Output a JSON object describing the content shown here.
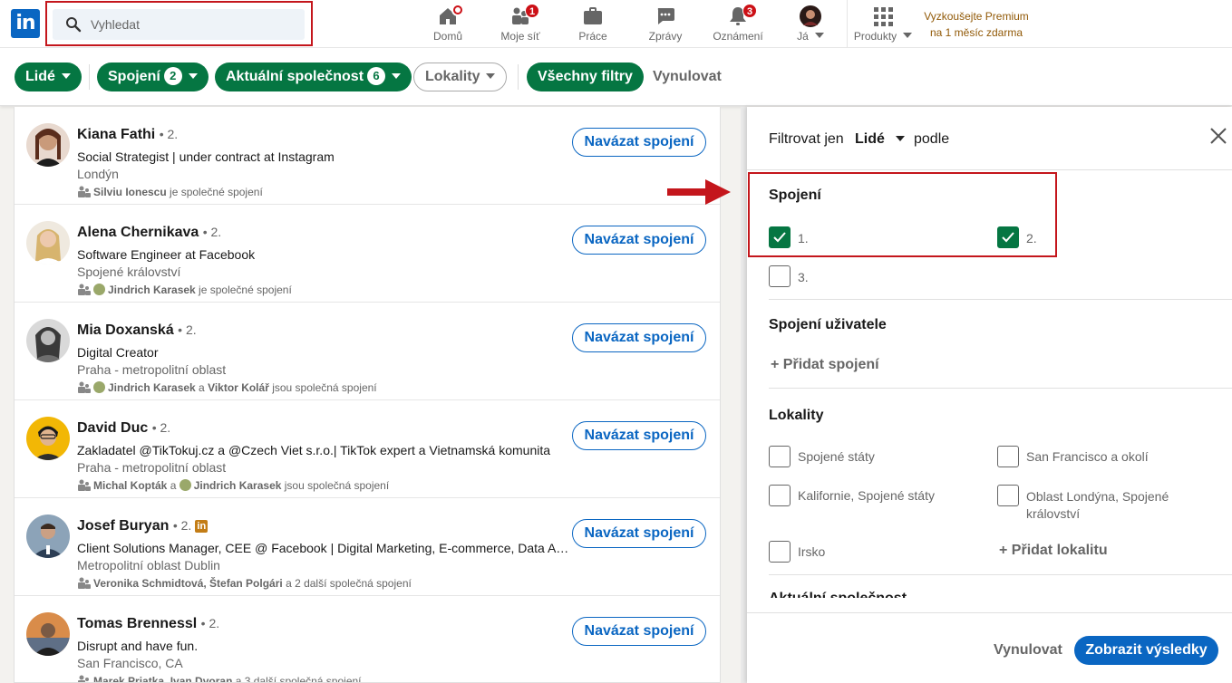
{
  "nav": {
    "logo": "in",
    "search_placeholder": "Vyhledat",
    "items": [
      {
        "label": "Domů"
      },
      {
        "label": "Moje síť",
        "badge": "1"
      },
      {
        "label": "Práce"
      },
      {
        "label": "Zprávy"
      },
      {
        "label": "Oznámení",
        "badge": "3"
      },
      {
        "label": "Já"
      },
      {
        "label": "Produkty"
      }
    ],
    "premium_line1": "Vyzkoušejte Premium",
    "premium_line2": "na 1 měsíc zdarma"
  },
  "filters": {
    "people": "Lidé",
    "connections": "Spojení",
    "connections_count": "2",
    "company": "Aktuální společnost",
    "company_count": "6",
    "locations": "Lokality",
    "all_filters": "Všechny filtry",
    "reset": "Vynulovat"
  },
  "results": [
    {
      "name": "Kiana Fathi",
      "degree": "• 2.",
      "headline": "Social Strategist | under contract at Instagram",
      "location": "Londýn",
      "mutual_names": "Silviu Ionescu",
      "mutual_suffix": " je společné spojení",
      "action": "Navázat spojení"
    },
    {
      "name": "Alena Chernikava",
      "degree": "• 2.",
      "headline": "Software Engineer at Facebook",
      "location": "Spojené království",
      "mutual_names": "Jindrich Karasek",
      "mutual_suffix": " je společné spojení",
      "action": "Navázat spojení"
    },
    {
      "name": "Mia Doxanská",
      "degree": "• 2.",
      "headline": "Digital Creator",
      "location": "Praha - metropolitní oblast",
      "mutual_names": "Jindrich Karasek",
      "mutual_mid": " a ",
      "mutual_names2": "Viktor Kolář",
      "mutual_suffix": " jsou společná spojení",
      "action": "Navázat spojení"
    },
    {
      "name": "David Duc",
      "degree": "• 2.",
      "headline": "Zakladatel @TikTokuj.cz a @Czech Viet s.r.o.| TikTok expert a Vietnamská komunita",
      "location": "Praha - metropolitní oblast",
      "mutual_names": "Michal Kopták",
      "mutual_mid": " a ",
      "mutual_names2": "Jindrich Karasek",
      "mutual_suffix": " jsou společná spojení",
      "action": "Navázat spojení"
    },
    {
      "name": "Josef Buryan",
      "degree": "• 2.",
      "premium": "in",
      "headline": "Client Solutions Manager, CEE @ Facebook | Digital Marketing, E-commerce, Data Analytics",
      "location": "Metropolitní oblast Dublin",
      "mutual_names": "Veronika Schmidtová, Štefan Polgári",
      "mutual_suffix": " a 2 další společná spojení",
      "action": "Navázat spojení"
    },
    {
      "name": "Tomas Brennessl",
      "degree": "• 2.",
      "headline": "Disrupt and have fun.",
      "location": "San Francisco, CA",
      "mutual_names": "Marek Priatka, Ivan Dvoran",
      "mutual_suffix": " a 3 další společná spojení",
      "action": "Navázat spojení"
    }
  ],
  "panel": {
    "filter_only": "Filtrovat jen",
    "selected": "Lidé",
    "by": "podle",
    "sec_connections": "Spojení",
    "cb_1": "1.",
    "cb_2": "2.",
    "cb_3": "3.",
    "sec_user_connections": "Spojení uživatele",
    "add_connection": "+ Přidat spojení",
    "sec_locations": "Lokality",
    "loc_1": "Spojené státy",
    "loc_2": "San Francisco a okolí",
    "loc_3": "Kalifornie, Spojené státy",
    "loc_4": "Oblast Londýna, Spojené království",
    "loc_5": "Irsko",
    "add_location": "+ Přidat lokalitu",
    "partial_section": "Aktuální společnost",
    "reset": "Vynulovat",
    "show_results": "Zobrazit výsledky"
  },
  "colors": {
    "brand": "#0a66c2",
    "green": "#057642",
    "highlight": "#c4161c"
  }
}
